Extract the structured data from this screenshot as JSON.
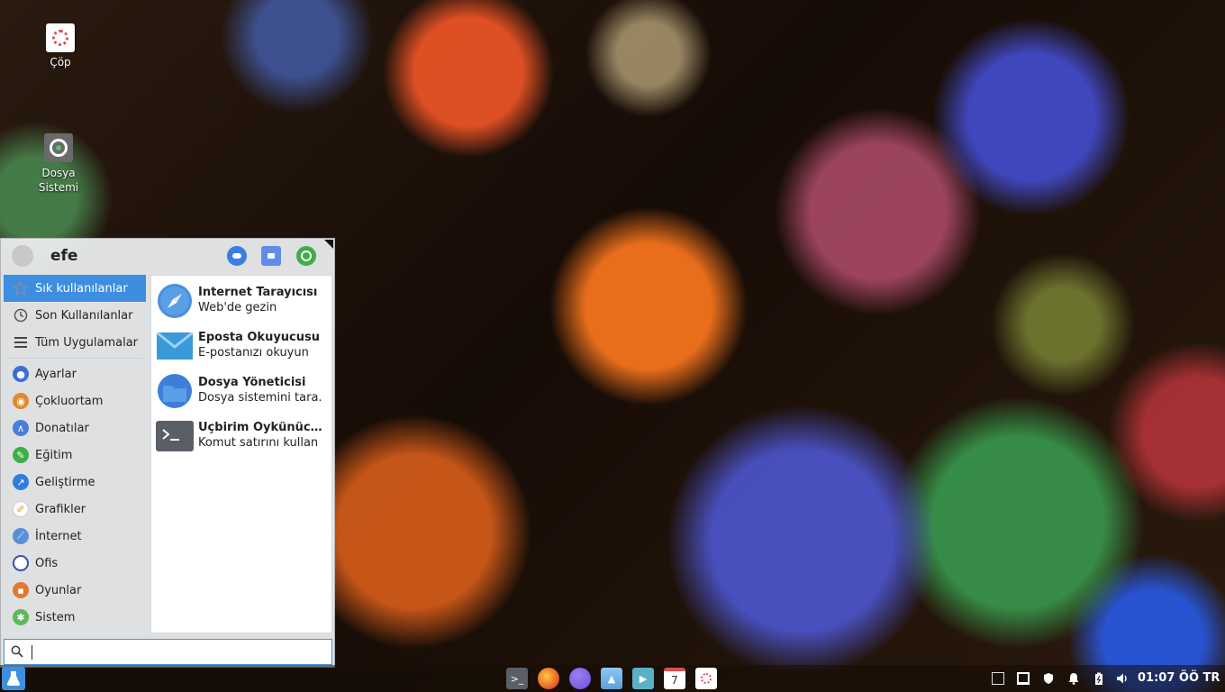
{
  "desktop": {
    "icons": [
      {
        "label": "Çöp"
      },
      {
        "label": "Dosya Sistemi"
      }
    ]
  },
  "menu": {
    "user_name": "efe",
    "categories_top": [
      {
        "label": "Sık kullanılanlar",
        "icon": "star-icon"
      },
      {
        "label": "Son Kullanılanlar",
        "icon": "clock-icon"
      },
      {
        "label": "Tüm Uygulamalar",
        "icon": "list-icon"
      }
    ],
    "categories": [
      {
        "label": "Ayarlar",
        "icon": "settings-icon",
        "color": "#3b6fd0"
      },
      {
        "label": "Çokluortam",
        "icon": "multimedia-icon",
        "color": "#e08a2a"
      },
      {
        "label": "Donatılar",
        "icon": "accessories-icon",
        "color": "#4a7fd8"
      },
      {
        "label": "Eğitim",
        "icon": "education-icon",
        "color": "#3fae4a"
      },
      {
        "label": "Geliştirme",
        "icon": "development-icon",
        "color": "#2d7fd8"
      },
      {
        "label": "Grafikler",
        "icon": "graphics-icon",
        "color": "#f0c030"
      },
      {
        "label": "İnternet",
        "icon": "internet-icon",
        "color": "#5a8fd8"
      },
      {
        "label": "Ofis",
        "icon": "office-icon",
        "color": "#3a4fb0"
      },
      {
        "label": "Oyunlar",
        "icon": "games-icon",
        "color": "#e07a30"
      },
      {
        "label": "Sistem",
        "icon": "system-icon",
        "color": "#5cb85c"
      }
    ],
    "apps": [
      {
        "name": "İnternet Tarayıcısı",
        "description": "Web'de gezin",
        "icon": "compass-icon",
        "color": "#4a90d9"
      },
      {
        "name": "Eposta Okuyucusu",
        "description": "E-postanızı okuyun",
        "icon": "envelope-icon",
        "color": "#3a9ad9"
      },
      {
        "name": "Dosya Yöneticisi",
        "description": "Dosya sistemini tara.",
        "icon": "folder-icon",
        "color": "#3d7fd8"
      },
      {
        "name": "Uçbirim Öykünücüsü",
        "description": "Komut satırını kullan",
        "icon": "terminal-icon",
        "color": "#5a5e66"
      }
    ],
    "search": {
      "value": "",
      "placeholder": ""
    }
  },
  "taskbar": {
    "launchers": [
      {
        "name": "terminal-icon",
        "color": "#5a5e66"
      },
      {
        "name": "firefox-icon",
        "color": "#e8652a"
      },
      {
        "name": "browser-icon",
        "color": "#6a4fe0"
      },
      {
        "name": "image-viewer-icon",
        "color": "#5aa0e0"
      },
      {
        "name": "video-icon",
        "color": "#5ab0c8"
      },
      {
        "name": "calendar-icon",
        "color": "#ffffff",
        "text": "7"
      },
      {
        "name": "trash-icon",
        "color": "#ffffff"
      }
    ],
    "clock": "01:07 ÖÖ TR"
  }
}
